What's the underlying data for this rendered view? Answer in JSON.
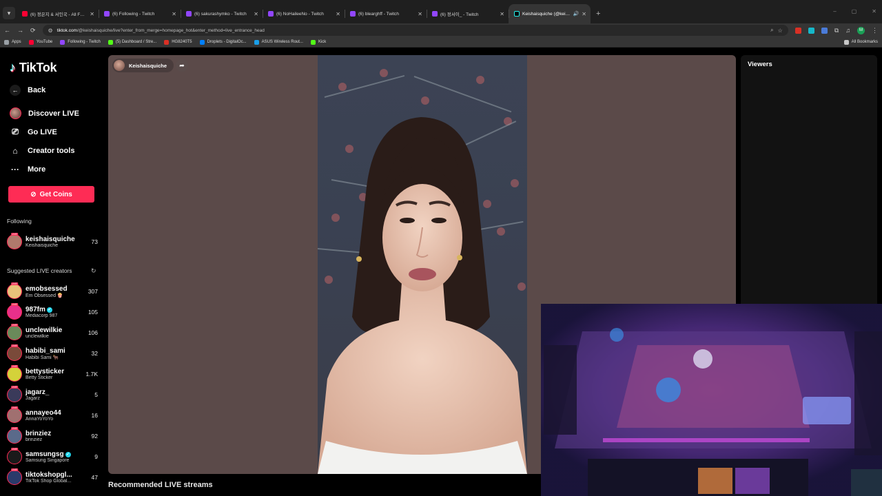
{
  "browser": {
    "tabs": [
      {
        "title": "(6) 정은지 & 서인국 - All For You",
        "favicon": "youtube",
        "active": false
      },
      {
        "title": "(6) Following - Twitch",
        "favicon": "twitch",
        "active": false
      },
      {
        "title": "(6) sakurashymko - Twitch",
        "favicon": "twitch",
        "active": false
      },
      {
        "title": "(6) NoHaileeNo - Twitch",
        "favicon": "twitch",
        "active": false
      },
      {
        "title": "(6) blearghff - Twitch",
        "favicon": "twitch",
        "active": false
      },
      {
        "title": "(6) 정서이_ - Twitch",
        "favicon": "twitch",
        "active": false
      },
      {
        "title": "Keishaisquiche (@keishais...",
        "favicon": "tiktok",
        "active": true
      }
    ],
    "url_host": "tiktok.com",
    "url_path": "/@keishaisquiche/live?enter_from_merge=homepage_hot&enter_method=live_entrance_head",
    "profile_initial": "M",
    "bookmarks": [
      {
        "label": "Apps",
        "color": "#9aa0a6"
      },
      {
        "label": "YouTube",
        "color": "#ff0033"
      },
      {
        "label": "Following - Twitch",
        "color": "#9146ff"
      },
      {
        "label": "(5) Dashboard / Stre...",
        "color": "#53fc18"
      },
      {
        "label": "HG8240T5",
        "color": "#d93025"
      },
      {
        "label": "Droplets - DigitalOc...",
        "color": "#0080ff"
      },
      {
        "label": "ASUS Wireless Rout...",
        "color": "#1a9ee8"
      },
      {
        "label": "Kick",
        "color": "#53fc18"
      }
    ],
    "all_bookmarks": "All Bookmarks"
  },
  "sidebar": {
    "brand": "TikTok",
    "nav": [
      {
        "label": "Back",
        "icon": "arrow-left-icon"
      },
      {
        "label": "Discover LIVE",
        "icon": "avatar"
      },
      {
        "label": "Go LIVE",
        "icon": "camera-icon"
      },
      {
        "label": "Creator tools",
        "icon": "home-icon"
      },
      {
        "label": "More",
        "icon": "ellipsis-icon"
      }
    ],
    "get_coins": "Get Coins",
    "following_title": "Following",
    "following": [
      {
        "name": "keishaisquiche",
        "sub": "Keishaisquiche",
        "count": "73",
        "color": "#b07a6c"
      }
    ],
    "suggested_title": "Suggested LIVE creators",
    "suggested": [
      {
        "name": "emobsessed",
        "sub": "Em Obsessed 🍿",
        "count": "307",
        "color": "#e9c27a",
        "verified": false
      },
      {
        "name": "987fm",
        "sub": "Mediacorp 987",
        "count": "105",
        "color": "#e8308a",
        "verified": true
      },
      {
        "name": "unclewilkie",
        "sub": "unclewilkie",
        "count": "106",
        "color": "#6a8a5a",
        "verified": false
      },
      {
        "name": "habibi_sami",
        "sub": "Habibi Sami 🐂",
        "count": "32",
        "color": "#7a4a3a",
        "verified": false
      },
      {
        "name": "bettysticker",
        "sub": "Betty Sticker",
        "count": "1.7K",
        "color": "#d4d23a",
        "verified": false
      },
      {
        "name": "jagarz_",
        "sub": "Jagarz",
        "count": "5",
        "color": "#3a3a5a",
        "verified": false
      },
      {
        "name": "annayeo44",
        "sub": "AnnaYoYoYo",
        "count": "16",
        "color": "#a07070",
        "verified": false
      },
      {
        "name": "brinziez",
        "sub": "brinziez",
        "count": "92",
        "color": "#5a6a8a",
        "verified": false
      },
      {
        "name": "samsungsg",
        "sub": "Samsung Singapore",
        "count": "9",
        "color": "#1a1a1a",
        "verified": true
      },
      {
        "name": "tiktokshopgl...",
        "sub": "TikTok Shop Global...",
        "count": "47",
        "color": "#2a3a6a",
        "verified": false
      }
    ]
  },
  "stream": {
    "host_name": "Keishaisquiche",
    "viewers_title": "Viewers",
    "recommended_title": "Recommended LIVE streams"
  }
}
